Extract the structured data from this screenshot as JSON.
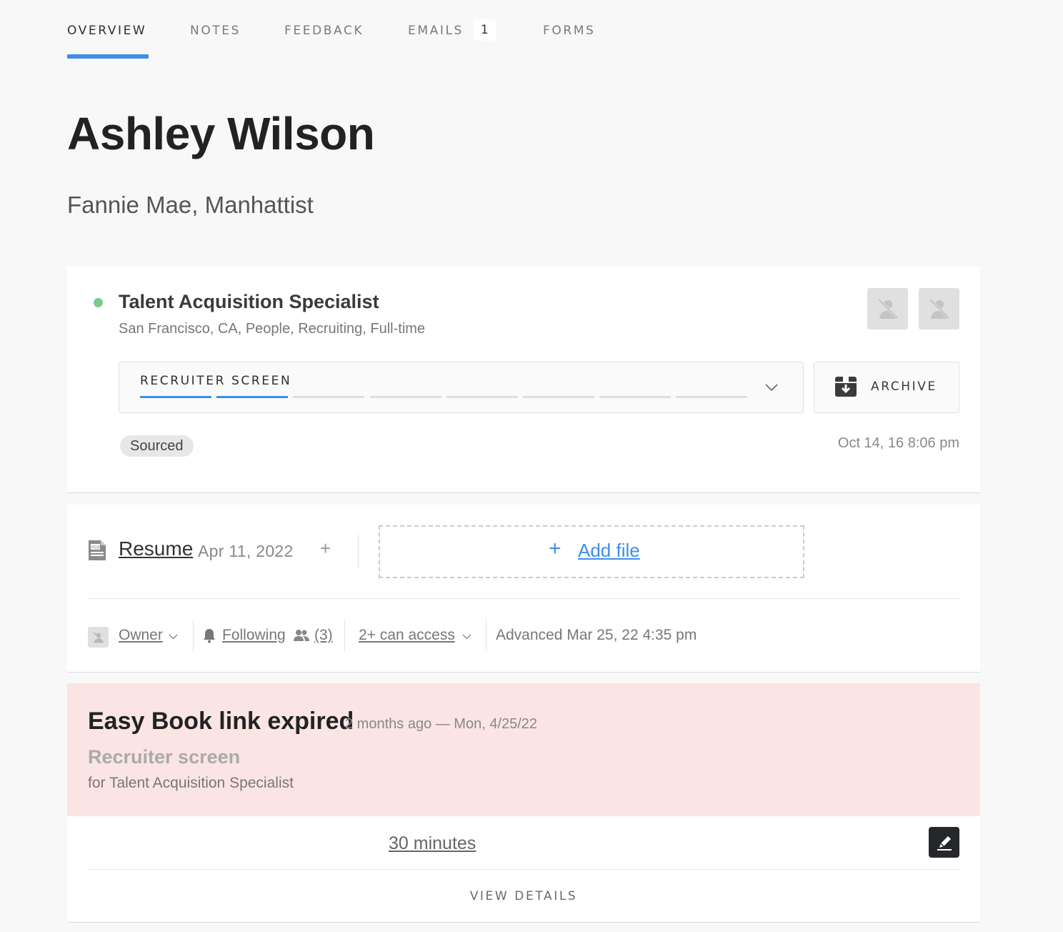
{
  "tabs": [
    {
      "label": "OVERVIEW",
      "active": true
    },
    {
      "label": "NOTES"
    },
    {
      "label": "FEEDBACK"
    },
    {
      "label": "EMAILS",
      "count": "1"
    },
    {
      "label": "FORMS"
    }
  ],
  "candidate": {
    "name": "Ashley Wilson",
    "subtitle": "Fannie Mae, Manhattist"
  },
  "opportunity": {
    "status_color": "#7acb8e",
    "job_title": "Talent Acquisition Specialist",
    "job_meta": "San Francisco, CA, People, Recruiting, Full-time",
    "stage_label": "RECRUITER SCREEN",
    "stage_progress": {
      "completed": 2,
      "total": 8
    },
    "archive_label": "ARCHIVE",
    "source_badge": "Sourced",
    "stage_date": "Oct 14, 16 8:06 pm"
  },
  "files": {
    "resume_label": "Resume",
    "resume_date": "Apr 11, 2022",
    "add_plus": "+",
    "add_file_plus": "+",
    "add_file_label": "Add file"
  },
  "meta": {
    "owner_label": "Owner",
    "following_label": "Following",
    "followers_count": "(3)",
    "access_label": "2+ can access",
    "advanced_text": "Advanced Mar 25, 22 4:35 pm"
  },
  "alert": {
    "title": "Easy Book link expired",
    "time": "2 months ago — Mon, 4/25/22",
    "subtitle": "Recruiter screen",
    "for_text": "for Talent Acquisition Specialist",
    "background": "#fbe4e4"
  },
  "event": {
    "duration": "30 minutes",
    "view_details": "VIEW DETAILS"
  },
  "colors": {
    "accent": "#3e8ee8",
    "status_green": "#7acb8e"
  },
  "icons": [
    "pdf-icon",
    "archive-box-icon",
    "chevron-down-icon",
    "bell-icon",
    "people-icon",
    "pencil-icon",
    "avatar-placeholder-icon"
  ]
}
